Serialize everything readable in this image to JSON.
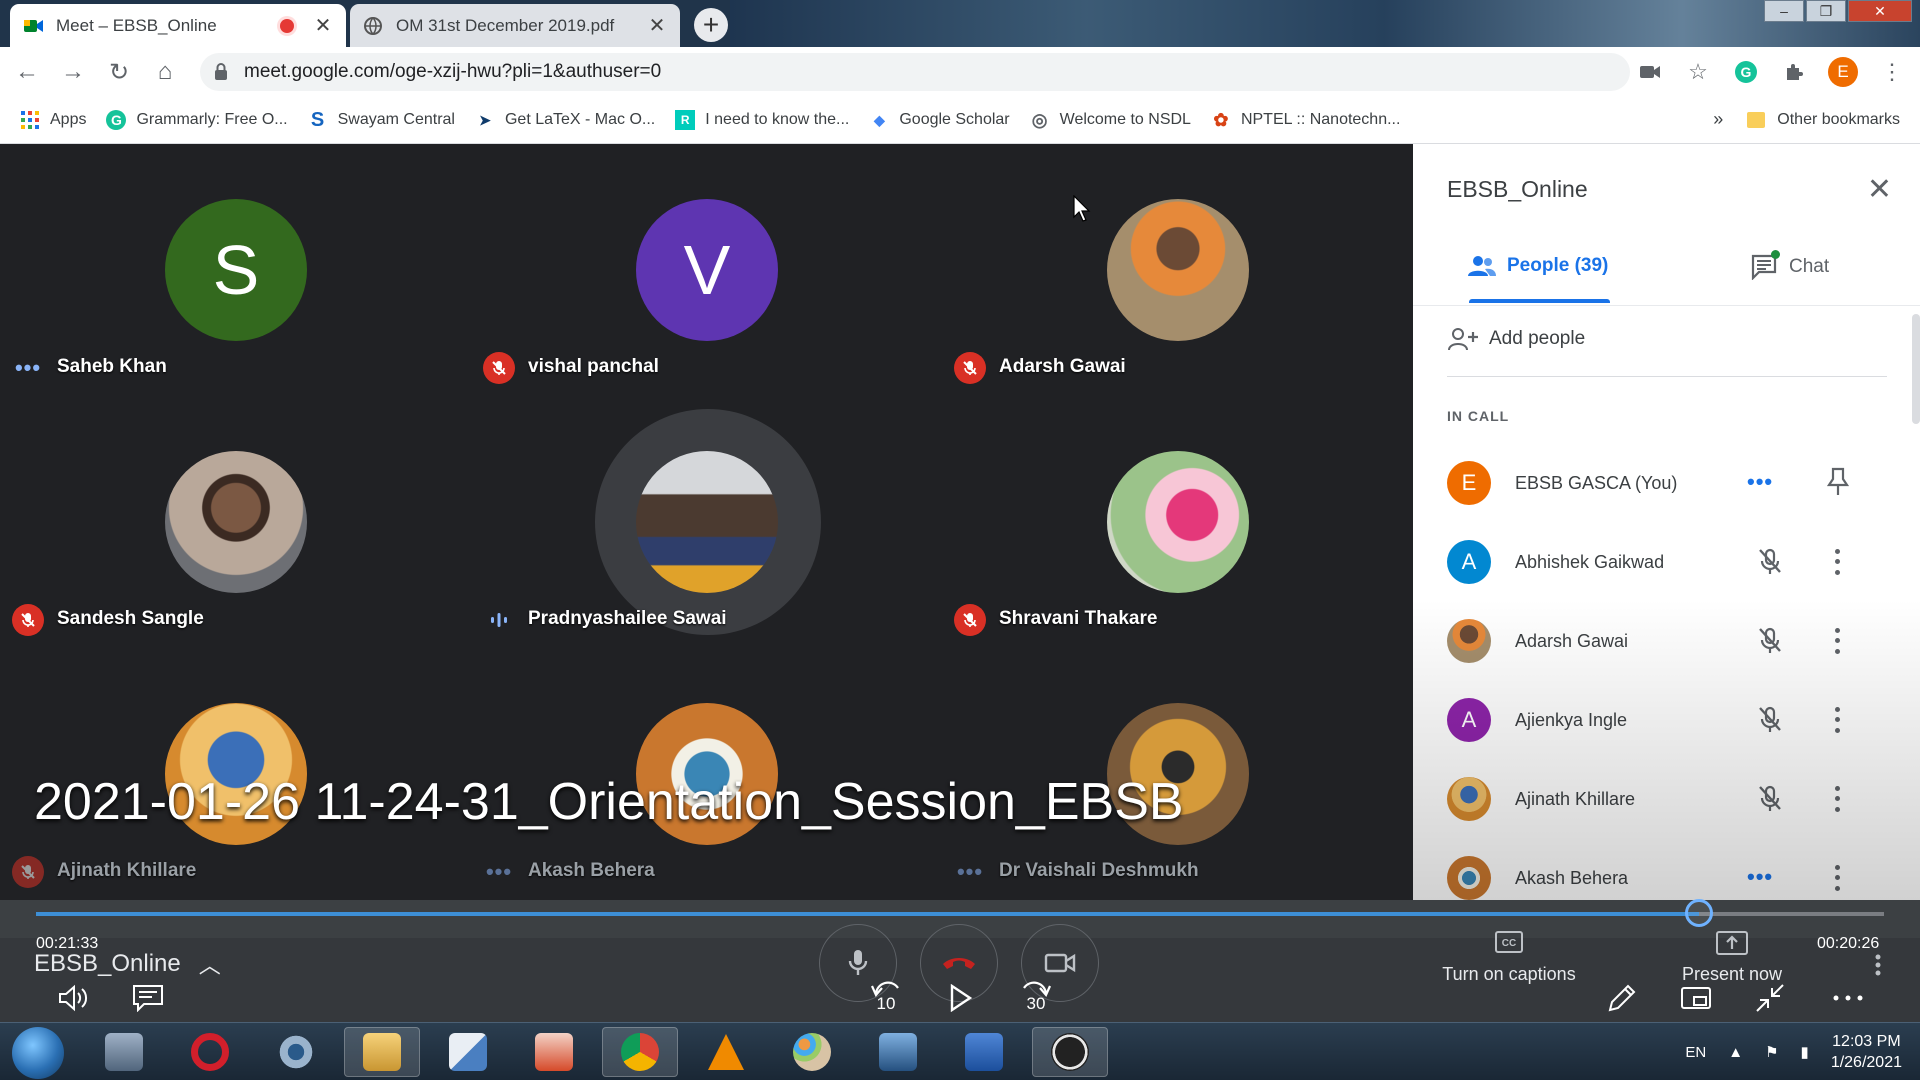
{
  "browser": {
    "tabs": [
      {
        "title": "Meet – EBSB_Online",
        "active": true
      },
      {
        "title": "OM 31st December 2019.pdf",
        "active": false
      }
    ],
    "url": "meet.google.com/oge-xzij-hwu?pli=1&authuser=0",
    "profile_initial": "E",
    "bookmarks": [
      {
        "label": "Apps",
        "icon": "apps-grid-icon"
      },
      {
        "label": "Grammarly: Free O...",
        "icon": "grammarly-icon"
      },
      {
        "label": "Swayam Central",
        "icon": "swayam-icon"
      },
      {
        "label": "Get LaTeX - Mac O...",
        "icon": "latex-icon"
      },
      {
        "label": "I need to know the...",
        "icon": "researchgate-icon"
      },
      {
        "label": "Google Scholar",
        "icon": "scholar-icon"
      },
      {
        "label": "Welcome to NSDL",
        "icon": "globe-icon"
      },
      {
        "label": "NPTEL :: Nanotechn...",
        "icon": "nptel-icon"
      }
    ],
    "other_bookmarks": "Other bookmarks",
    "overflow": "»"
  },
  "grid": {
    "participants": [
      {
        "name": "Saheb Khan",
        "initial": "S",
        "color": "#33691e",
        "status": "dots"
      },
      {
        "name": "vishal panchal",
        "initial": "V",
        "color": "#5e35b1",
        "status": "muted"
      },
      {
        "name": "Adarsh Gawai",
        "initial": "",
        "color": "#b38a5f",
        "status": "muted"
      },
      {
        "name": "Sandesh Sangle",
        "initial": "",
        "color": "#9c7b62",
        "status": "muted"
      },
      {
        "name": "Pradnyashailee Sawai",
        "initial": "",
        "color": "#6d5a4a",
        "status": "speaking"
      },
      {
        "name": "Shravani Thakare",
        "initial": "",
        "color": "#e28aa5",
        "status": "muted"
      },
      {
        "name": "Ajinath Khillare",
        "initial": "",
        "color": "#c79a4a",
        "status": "muted"
      },
      {
        "name": "Akash Behera",
        "initial": "",
        "color": "#c9772e",
        "status": "dots"
      },
      {
        "name": "Dr Vaishali Deshmukh",
        "initial": "",
        "color": "#7a5a3a",
        "status": "dots"
      }
    ]
  },
  "panel": {
    "title": "EBSB_Online",
    "tab_people": "People (39)",
    "tab_chat": "Chat",
    "add_people": "Add people",
    "section_label": "IN CALL",
    "members": [
      {
        "name": "EBSB GASCA (You)",
        "initial": "E",
        "color": "#ef6c00",
        "status": "dots",
        "action": "pin"
      },
      {
        "name": "Abhishek Gaikwad",
        "initial": "A",
        "color": "#0288d1",
        "status": "muted",
        "action": "more"
      },
      {
        "name": "Adarsh Gawai",
        "initial": "",
        "color": "#b38a5f",
        "status": "muted",
        "action": "more"
      },
      {
        "name": "Ajienkya Ingle",
        "initial": "A",
        "color": "#8e24aa",
        "status": "muted",
        "action": "more"
      },
      {
        "name": "Ajinath Khillare",
        "initial": "",
        "color": "#c79a4a",
        "status": "muted",
        "action": "more"
      },
      {
        "name": "Akash Behera",
        "initial": "",
        "color": "#c9772e",
        "status": "dots",
        "action": "more"
      }
    ]
  },
  "player": {
    "title": "2021-01-26 11-24-31_Orientation_Session_EBSB",
    "elapsed": "00:21:33",
    "remaining": "00:20:26",
    "progress": 0.9,
    "meeting_name": "EBSB_Online",
    "captions_label": "Turn on captions",
    "present_label": "Present now",
    "rewind_seconds": "10",
    "forward_seconds": "30"
  },
  "taskbar": {
    "language": "EN",
    "time": "12:03 PM",
    "date": "1/26/2021"
  }
}
